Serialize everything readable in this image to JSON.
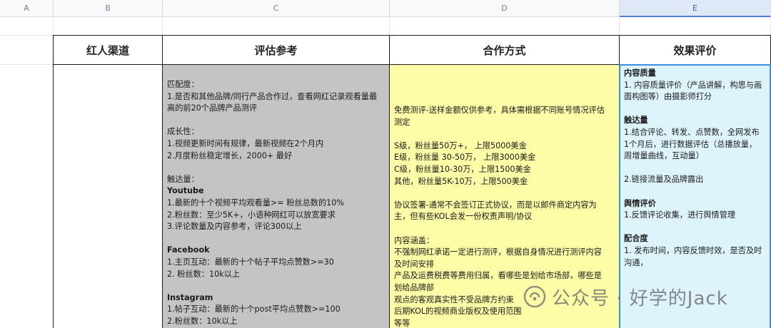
{
  "columns": [
    "A",
    "B",
    "C",
    "D",
    "E"
  ],
  "headers": {
    "b": "红人渠道",
    "c": "评估参考",
    "d": "合作方式",
    "e": "效果评价"
  },
  "col_c_lines": [
    {
      "t": "匹配度：",
      "bold": false
    },
    {
      "t": "1.是否和其他品牌/同行产品合作过，查看网红记录观看量最",
      "bold": false
    },
    {
      "t": "高的前20个品牌产品测评",
      "bold": false
    },
    {
      "t": "",
      "bold": false
    },
    {
      "t": "成长性：",
      "bold": false
    },
    {
      "t": "1.视频更新时间有规律，最新视频在2个月内",
      "bold": false
    },
    {
      "t": "2.月度粉丝稳定增长，2000+ 最好",
      "bold": false
    },
    {
      "t": "",
      "bold": false
    },
    {
      "t": "触达量：",
      "bold": false
    },
    {
      "t": "Youtube",
      "bold": true
    },
    {
      "t": "1.最新的十个视频平均观看量>= 粉丝总数的10%",
      "bold": false
    },
    {
      "t": "2.粉丝数：至少5K+，小语种网红可以放宽要求",
      "bold": false
    },
    {
      "t": "3.评论数量及内容参考，评论300以上",
      "bold": false
    },
    {
      "t": "",
      "bold": false
    },
    {
      "t": "Facebook",
      "bold": true
    },
    {
      "t": "1.主页互动：最新的十个帖子平均点赞数>=30",
      "bold": false
    },
    {
      "t": "2. 粉丝数：10k以上",
      "bold": false
    },
    {
      "t": "",
      "bold": false
    },
    {
      "t": "Instagram",
      "bold": true
    },
    {
      "t": "1.帖子互动：最新的十个post平均点赞数>=100",
      "bold": false
    },
    {
      "t": "2.粉丝数：10k以上",
      "bold": false
    }
  ],
  "col_d_lines": [
    {
      "t": "免费测评-送样金额仅供参考，具体需根据不同账号情况评估",
      "bold": false
    },
    {
      "t": "测定",
      "bold": false
    },
    {
      "t": "",
      "bold": false
    },
    {
      "t": "S级，粉丝量50万+，  上限5000美金",
      "bold": false
    },
    {
      "t": "E级，粉丝量 30-50万，  上限3000美金",
      "bold": false
    },
    {
      "t": "C级，粉丝量10-30万，上限1500美金",
      "bold": false
    },
    {
      "t": "其他，粉丝量5K-10万，上限500美金",
      "bold": false
    },
    {
      "t": "",
      "bold": false
    },
    {
      "t": "协议签署-通常不会签订正式协议，而是以邮件商定内容为",
      "bold": false
    },
    {
      "t": "主，但有些KOL会发一份权责声明/协议",
      "bold": false
    },
    {
      "t": "",
      "bold": false
    },
    {
      "t": "内容涵盖：",
      "bold": false
    },
    {
      "t": "不强制网红承诺一定进行测评，根据自身情况进行测评内容",
      "bold": false
    },
    {
      "t": "及时间安排",
      "bold": false
    },
    {
      "t": "产品及运费税费等费用归属，看哪些是划给市场部，哪些是",
      "bold": false
    },
    {
      "t": "划给品牌部",
      "bold": false
    },
    {
      "t": "观点的客观真实性不受品牌方约束",
      "bold": false
    },
    {
      "t": "后期KOL的视频商业版权及使用范围",
      "bold": false
    },
    {
      "t": "等等",
      "bold": false
    }
  ],
  "col_e_lines": [
    {
      "t": "内容质量",
      "bold": true
    },
    {
      "t": "1. 内容质量评价（产品讲解，构思与画",
      "bold": false
    },
    {
      "t": "面构图等）由摄影师打分",
      "bold": false
    },
    {
      "t": "",
      "bold": false
    },
    {
      "t": "触达量",
      "bold": true
    },
    {
      "t": "1.结合评论、转发、点赞数，全网发布",
      "bold": false
    },
    {
      "t": "1个月后，进行数据评估（总播放量，",
      "bold": false
    },
    {
      "t": "周增量曲线，互动量）",
      "bold": false
    },
    {
      "t": "",
      "bold": false
    },
    {
      "t": "2.链接流量及品牌露出",
      "bold": false
    },
    {
      "t": "",
      "bold": false
    },
    {
      "t": "舆情评价",
      "bold": true
    },
    {
      "t": "1.反馈评论收集，进行舆情管理",
      "bold": false
    },
    {
      "t": "",
      "bold": false
    },
    {
      "t": "配合度",
      "bold": true
    },
    {
      "t": "1. 发布时间，内容反馈时效，是否及时",
      "bold": false
    },
    {
      "t": "沟通，",
      "bold": false
    }
  ],
  "watermark": {
    "text": "公众号 · 好学的Jack",
    "icon": "wechat-official-account-icon"
  },
  "colors": {
    "gray": "#c4c4c4",
    "yellow": "#fdfda7",
    "blue": "#def4fc",
    "selection": "#3f8fe0"
  }
}
